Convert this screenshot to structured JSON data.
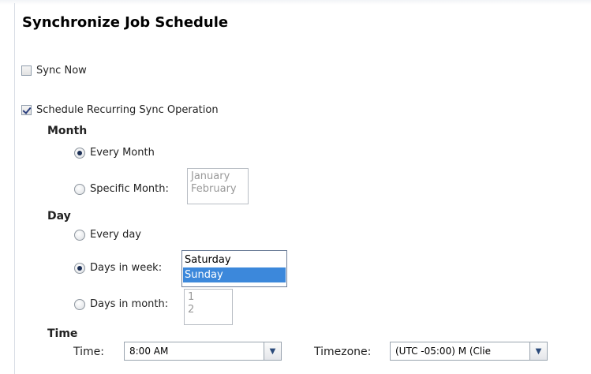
{
  "title": "Synchronize Job Schedule",
  "sync_now": {
    "label": "Sync Now",
    "checked": false
  },
  "recurring": {
    "label": "Schedule Recurring Sync Operation",
    "checked": true
  },
  "month": {
    "heading": "Month",
    "every_label": "Every Month",
    "specific_label": "Specific Month:",
    "selected": "every",
    "options": [
      "January",
      "February"
    ]
  },
  "day": {
    "heading": "Day",
    "every_label": "Every day",
    "week_label": "Days in week:",
    "month_label": "Days in month:",
    "selected": "week",
    "week_options": [
      "Saturday",
      "Sunday"
    ],
    "week_selected": "Sunday",
    "month_options": [
      "1",
      "2"
    ]
  },
  "time": {
    "heading": "Time",
    "time_label": "Time:",
    "time_value": "8:00 AM",
    "timezone_label": "Timezone:",
    "timezone_value": "(UTC -05:00) M (Clie"
  },
  "icons": {
    "dropdown": "chevron-down-icon"
  }
}
